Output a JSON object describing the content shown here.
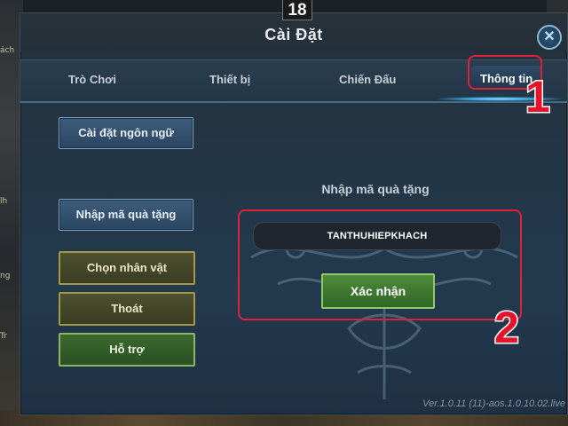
{
  "age_rating": "18",
  "background_glimpse": [
    "ách",
    "lh",
    "ng",
    "Tr"
  ],
  "dialog": {
    "title": "Cài Đặt",
    "close_icon": "✕"
  },
  "tabs": [
    {
      "label": "Trò Chơi",
      "active": false
    },
    {
      "label": "Thiết bị",
      "active": false
    },
    {
      "label": "Chiến Đấu",
      "active": false
    },
    {
      "label": "Thông tin",
      "active": true
    }
  ],
  "side_menu": [
    {
      "label": "Cài đặt ngôn ngữ",
      "style": "blue"
    },
    {
      "label": "Nhập mã quà tặng",
      "style": "blue"
    },
    {
      "label": "Chọn nhân vật",
      "style": "olive"
    },
    {
      "label": "Thoát",
      "style": "olive"
    },
    {
      "label": "Hỗ trợ",
      "style": "green"
    }
  ],
  "gift_code": {
    "section_title": "Nhập mã quà tặng",
    "input_value": "TANTHUHIEPKHACH",
    "confirm_label": "Xác nhận"
  },
  "annotations": {
    "marker_1": "1",
    "marker_2": "2",
    "highlight_color": "#e0203a"
  },
  "version_text": "Ver.1.0.11 (11)-aos.1.0.10.02.live"
}
